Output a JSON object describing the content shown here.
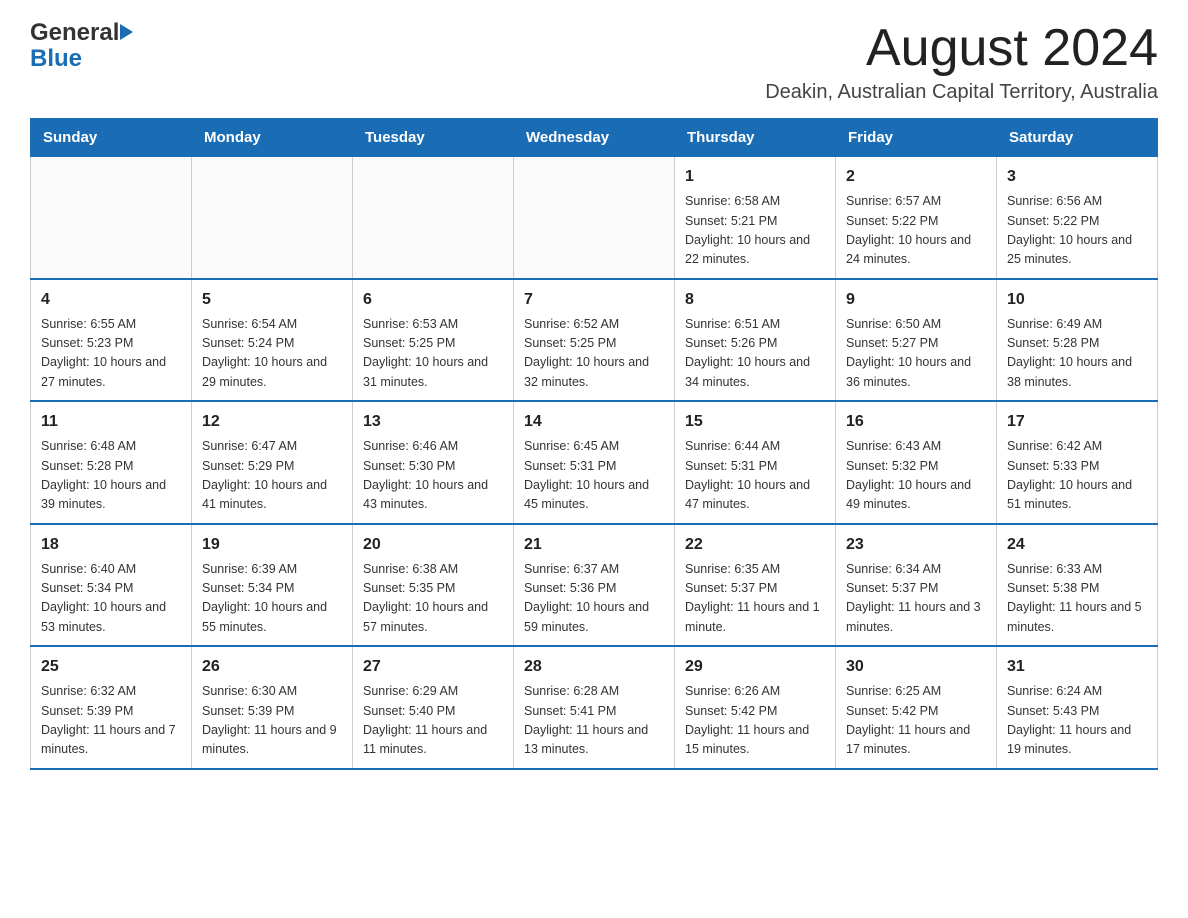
{
  "header": {
    "logo_general": "General",
    "logo_blue": "Blue",
    "month_title": "August 2024",
    "location": "Deakin, Australian Capital Territory, Australia"
  },
  "calendar": {
    "days_of_week": [
      "Sunday",
      "Monday",
      "Tuesday",
      "Wednesday",
      "Thursday",
      "Friday",
      "Saturday"
    ],
    "weeks": [
      [
        {
          "day": "",
          "info": ""
        },
        {
          "day": "",
          "info": ""
        },
        {
          "day": "",
          "info": ""
        },
        {
          "day": "",
          "info": ""
        },
        {
          "day": "1",
          "info": "Sunrise: 6:58 AM\nSunset: 5:21 PM\nDaylight: 10 hours and 22 minutes."
        },
        {
          "day": "2",
          "info": "Sunrise: 6:57 AM\nSunset: 5:22 PM\nDaylight: 10 hours and 24 minutes."
        },
        {
          "day": "3",
          "info": "Sunrise: 6:56 AM\nSunset: 5:22 PM\nDaylight: 10 hours and 25 minutes."
        }
      ],
      [
        {
          "day": "4",
          "info": "Sunrise: 6:55 AM\nSunset: 5:23 PM\nDaylight: 10 hours and 27 minutes."
        },
        {
          "day": "5",
          "info": "Sunrise: 6:54 AM\nSunset: 5:24 PM\nDaylight: 10 hours and 29 minutes."
        },
        {
          "day": "6",
          "info": "Sunrise: 6:53 AM\nSunset: 5:25 PM\nDaylight: 10 hours and 31 minutes."
        },
        {
          "day": "7",
          "info": "Sunrise: 6:52 AM\nSunset: 5:25 PM\nDaylight: 10 hours and 32 minutes."
        },
        {
          "day": "8",
          "info": "Sunrise: 6:51 AM\nSunset: 5:26 PM\nDaylight: 10 hours and 34 minutes."
        },
        {
          "day": "9",
          "info": "Sunrise: 6:50 AM\nSunset: 5:27 PM\nDaylight: 10 hours and 36 minutes."
        },
        {
          "day": "10",
          "info": "Sunrise: 6:49 AM\nSunset: 5:28 PM\nDaylight: 10 hours and 38 minutes."
        }
      ],
      [
        {
          "day": "11",
          "info": "Sunrise: 6:48 AM\nSunset: 5:28 PM\nDaylight: 10 hours and 39 minutes."
        },
        {
          "day": "12",
          "info": "Sunrise: 6:47 AM\nSunset: 5:29 PM\nDaylight: 10 hours and 41 minutes."
        },
        {
          "day": "13",
          "info": "Sunrise: 6:46 AM\nSunset: 5:30 PM\nDaylight: 10 hours and 43 minutes."
        },
        {
          "day": "14",
          "info": "Sunrise: 6:45 AM\nSunset: 5:31 PM\nDaylight: 10 hours and 45 minutes."
        },
        {
          "day": "15",
          "info": "Sunrise: 6:44 AM\nSunset: 5:31 PM\nDaylight: 10 hours and 47 minutes."
        },
        {
          "day": "16",
          "info": "Sunrise: 6:43 AM\nSunset: 5:32 PM\nDaylight: 10 hours and 49 minutes."
        },
        {
          "day": "17",
          "info": "Sunrise: 6:42 AM\nSunset: 5:33 PM\nDaylight: 10 hours and 51 minutes."
        }
      ],
      [
        {
          "day": "18",
          "info": "Sunrise: 6:40 AM\nSunset: 5:34 PM\nDaylight: 10 hours and 53 minutes."
        },
        {
          "day": "19",
          "info": "Sunrise: 6:39 AM\nSunset: 5:34 PM\nDaylight: 10 hours and 55 minutes."
        },
        {
          "day": "20",
          "info": "Sunrise: 6:38 AM\nSunset: 5:35 PM\nDaylight: 10 hours and 57 minutes."
        },
        {
          "day": "21",
          "info": "Sunrise: 6:37 AM\nSunset: 5:36 PM\nDaylight: 10 hours and 59 minutes."
        },
        {
          "day": "22",
          "info": "Sunrise: 6:35 AM\nSunset: 5:37 PM\nDaylight: 11 hours and 1 minute."
        },
        {
          "day": "23",
          "info": "Sunrise: 6:34 AM\nSunset: 5:37 PM\nDaylight: 11 hours and 3 minutes."
        },
        {
          "day": "24",
          "info": "Sunrise: 6:33 AM\nSunset: 5:38 PM\nDaylight: 11 hours and 5 minutes."
        }
      ],
      [
        {
          "day": "25",
          "info": "Sunrise: 6:32 AM\nSunset: 5:39 PM\nDaylight: 11 hours and 7 minutes."
        },
        {
          "day": "26",
          "info": "Sunrise: 6:30 AM\nSunset: 5:39 PM\nDaylight: 11 hours and 9 minutes."
        },
        {
          "day": "27",
          "info": "Sunrise: 6:29 AM\nSunset: 5:40 PM\nDaylight: 11 hours and 11 minutes."
        },
        {
          "day": "28",
          "info": "Sunrise: 6:28 AM\nSunset: 5:41 PM\nDaylight: 11 hours and 13 minutes."
        },
        {
          "day": "29",
          "info": "Sunrise: 6:26 AM\nSunset: 5:42 PM\nDaylight: 11 hours and 15 minutes."
        },
        {
          "day": "30",
          "info": "Sunrise: 6:25 AM\nSunset: 5:42 PM\nDaylight: 11 hours and 17 minutes."
        },
        {
          "day": "31",
          "info": "Sunrise: 6:24 AM\nSunset: 5:43 PM\nDaylight: 11 hours and 19 minutes."
        }
      ]
    ]
  }
}
